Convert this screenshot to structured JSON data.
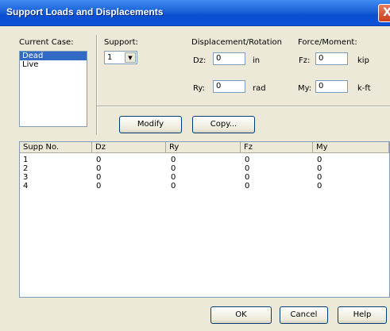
{
  "window": {
    "title": "Support Loads and Displacements",
    "close_glyph": "X"
  },
  "current_case": {
    "label": "Current Case:",
    "items": [
      "Dead",
      "Live"
    ],
    "selected": "Dead"
  },
  "support": {
    "label": "Support:",
    "selected": "1"
  },
  "displacement": {
    "heading": "Displacement/Rotation",
    "dz_label": "Dz:",
    "dz_value": "0",
    "dz_unit": "in",
    "ry_label": "Ry:",
    "ry_value": "0",
    "ry_unit": "rad"
  },
  "force": {
    "heading": "Force/Moment:",
    "fz_label": "Fz:",
    "fz_value": "0",
    "fz_unit": "kip",
    "my_label": "My:",
    "my_value": "0",
    "my_unit": "k-ft"
  },
  "buttons": {
    "modify": "Modify",
    "copy": "Copy...",
    "ok": "OK",
    "cancel": "Cancel",
    "help": "Help"
  },
  "table": {
    "headers": [
      "Supp No.",
      "Dz",
      "Ry",
      "Fz",
      "My"
    ],
    "rows": [
      [
        "1",
        "0",
        "0",
        "0",
        "0"
      ],
      [
        "2",
        "0",
        "0",
        "0",
        "0"
      ],
      [
        "3",
        "0",
        "0",
        "0",
        "0"
      ],
      [
        "4",
        "0",
        "0",
        "0",
        "0"
      ]
    ]
  }
}
